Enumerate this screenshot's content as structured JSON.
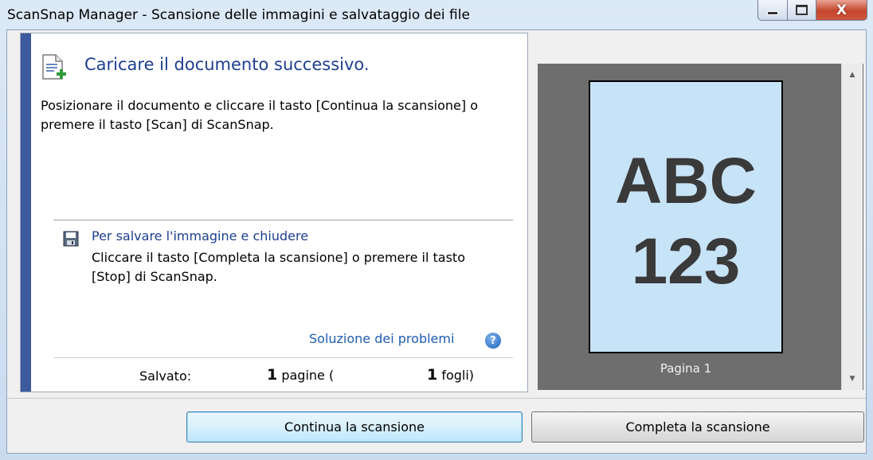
{
  "window": {
    "title": "ScanSnap Manager - Scansione delle immagini e salvataggio dei file",
    "controls": {
      "minimize_icon": "minimize-icon",
      "maximize_icon": "maximize-icon",
      "close_icon": "close-icon",
      "close_glyph": "X"
    }
  },
  "info": {
    "heading": "Caricare il documento successivo.",
    "instruction": "Posizionare il documento e cliccare il tasto [Continua la scansione] o premere il tasto [Scan] di ScanSnap.",
    "save_heading": "Per salvare l'immagine e chiudere",
    "save_text": "Cliccare il tasto [Completa la scansione] o premere il tasto [Stop] di ScanSnap.",
    "help_link": "Soluzione dei problemi",
    "help_glyph": "?",
    "status": {
      "label": "Salvato:",
      "pages_count": "1",
      "pages_text": " pagine (",
      "sheets_count": "1",
      "sheets_text": " fogli)"
    }
  },
  "preview": {
    "line1": "ABC",
    "line2": "123",
    "caption": "Pagina 1"
  },
  "scroll": {
    "up": "▲",
    "down": "▼"
  },
  "buttons": {
    "continue": "Continua la scansione",
    "finish": "Completa la scansione"
  },
  "colors": {
    "accent_bar": "#3e5a9e",
    "link": "#1e5cb3",
    "heading": "#1e3f8f",
    "preview_bg": "#6e6e6e",
    "page_bg": "#c7e3f7"
  }
}
